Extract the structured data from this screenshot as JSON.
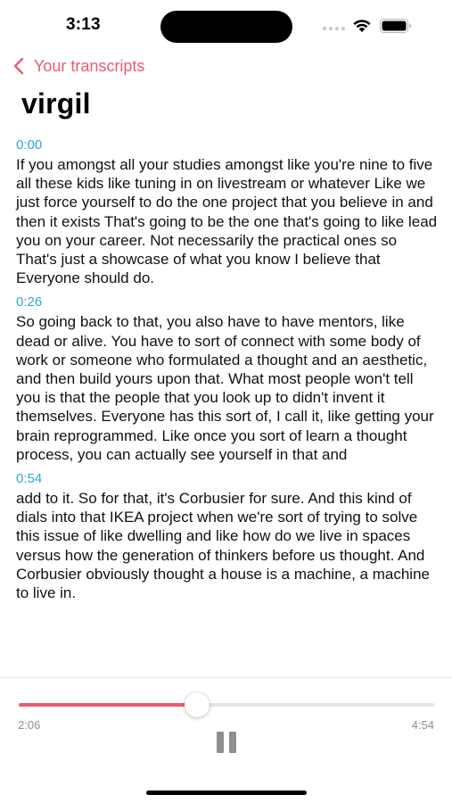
{
  "status_bar": {
    "time": "3:13"
  },
  "nav": {
    "back_label": "Your transcripts"
  },
  "title": "virgil",
  "segments": [
    {
      "timestamp": "0:00",
      "text": "If you amongst all your studies amongst like you're nine to five all these kids like tuning in on livestream or whatever Like we just force yourself to do the one project that you believe in and then it exists That's going to be the one that's going to like lead you on your career. Not necessarily the practical ones so That's just a showcase of what you know I believe that Everyone should do."
    },
    {
      "timestamp": "0:26",
      "text": "So going back to that, you also have to have mentors, like dead or alive. You have to sort of connect with some body of work or someone who formulated a thought and an aesthetic, and then build yours upon that. What most people won't tell you is that the people that you look up to didn't invent it themselves. Everyone has this sort of, I call it, like getting your brain reprogrammed. Like once you sort of learn a thought process, you can actually see yourself in that and"
    },
    {
      "timestamp": "0:54",
      "text": "add to it. So for that, it's Corbusier for sure. And this kind of dials into that IKEA project when we're sort of trying to solve this issue of like dwelling and like how do we live in spaces versus how the generation of thinkers before us thought. And Corbusier obviously thought a house is a machine, a machine to live in."
    }
  ],
  "player": {
    "elapsed": "2:06",
    "total": "4:54",
    "progress": 0.4286,
    "state": "playing",
    "button_icon": "pause-icon"
  },
  "colors": {
    "accent": "#ec5a6e",
    "timestamp": "#2aa6d8",
    "track": "#e5e5ea"
  }
}
